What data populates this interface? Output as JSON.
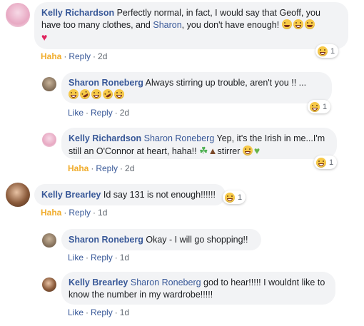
{
  "comments": [
    {
      "author": "Kelly Richardson",
      "text1": " Perfectly normal, in fact, I would say that Geoff, you have too many clothes, and ",
      "mention": "Sharon",
      "text2": ", you don't have enough! ",
      "reaction_label": "Haha",
      "reply": "Reply",
      "time": "2d",
      "reaction_count": "1"
    },
    {
      "author": "Sharon Roneberg",
      "text1": " Always stirring up trouble, aren't you !! ...",
      "like": "Like",
      "reply": "Reply",
      "time": "2d",
      "reaction_count": "1"
    },
    {
      "author": "Kelly Richardson",
      "mention": "Sharon Roneberg",
      "text1": " Yep, it's the Irish in me...I'm still an O'Connor at heart, haha!! ",
      "text2": "stirrer ",
      "reaction_label": "Haha",
      "reply": "Reply",
      "time": "2d",
      "reaction_count": "1"
    },
    {
      "author": "Kelly Brearley",
      "text1": " Id say 131 is not enough!!!!!!",
      "reaction_label": "Haha",
      "reply": "Reply",
      "time": "1d",
      "reaction_count": "1"
    },
    {
      "author": "Sharon Roneberg",
      "text1": " Okay - I will go shopping!!",
      "like": "Like",
      "reply": "Reply",
      "time": "1d"
    },
    {
      "author": "Kelly Brearley",
      "mention": "Sharon Roneberg",
      "text1": " god to hear!!!!! I wouldnt like to know the number in my wardrobe!!!!!",
      "like": "Like",
      "reply": "Reply",
      "time": "1d"
    }
  ],
  "separator": "·"
}
